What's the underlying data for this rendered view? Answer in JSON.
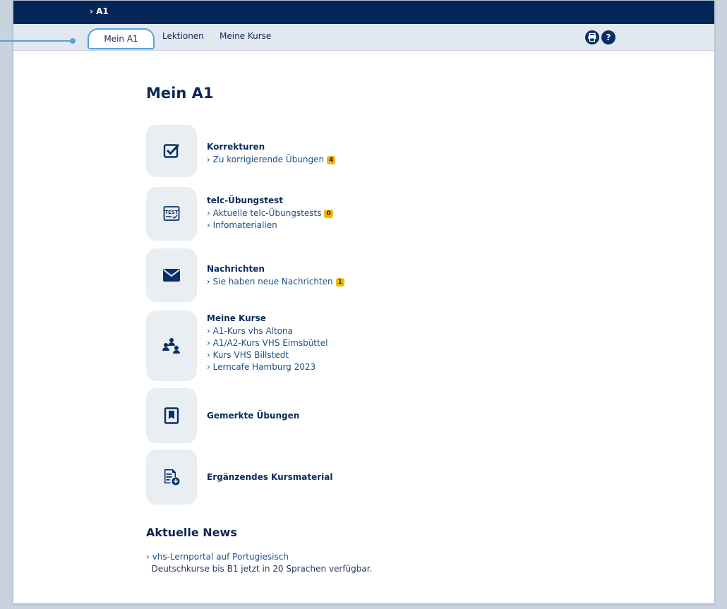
{
  "topbar": {
    "breadcrumb": "› A1"
  },
  "nav": {
    "tabs": [
      {
        "label": "Mein A1",
        "active": true
      },
      {
        "label": "Lektionen",
        "active": false
      },
      {
        "label": "Meine Kurse",
        "active": false
      }
    ],
    "icons": [
      "print-icon",
      "help-icon"
    ]
  },
  "main": {
    "title": "Mein A1",
    "sections": [
      {
        "heading": "Korrekturen",
        "icon": "checkbox-icon",
        "links": [
          {
            "text": "› Zu korrigierende Übungen",
            "badge": "4"
          }
        ]
      },
      {
        "heading": "telc-Übungstest",
        "icon": "test-icon",
        "links": [
          {
            "text": "› Aktuelle telc-Übungstests",
            "badge": "0"
          },
          {
            "text": "› Infomaterialien"
          }
        ]
      },
      {
        "heading": "Nachrichten",
        "icon": "envelope-icon",
        "links": [
          {
            "text": "› Sie haben neue Nachrichten",
            "badge": "1"
          }
        ]
      },
      {
        "heading": "Meine Kurse",
        "icon": "group-icon",
        "links": [
          {
            "text": "› A1-Kurs vhs Altona"
          },
          {
            "text": "› A1/A2-Kurs VHS Eimsbüttel"
          },
          {
            "text": "› Kurs VHS Billstedt"
          },
          {
            "text": "› Lerncafe Hamburg 2023"
          }
        ]
      },
      {
        "heading": "Gemerkte Übungen",
        "icon": "bookmark-icon",
        "links": []
      },
      {
        "heading": "Ergänzendes Kursmaterial",
        "icon": "add-document-icon",
        "links": []
      }
    ],
    "news": {
      "title": "Aktuelle News",
      "link": "› vhs-Lernportal auf Portugiesisch",
      "text": "Deutschkurse bis B1 jetzt in 20 Sprachen verfügbar."
    }
  },
  "colors": {
    "topbar": "#042656",
    "accent": "#5aa2d6",
    "badge": "#f5b800"
  }
}
